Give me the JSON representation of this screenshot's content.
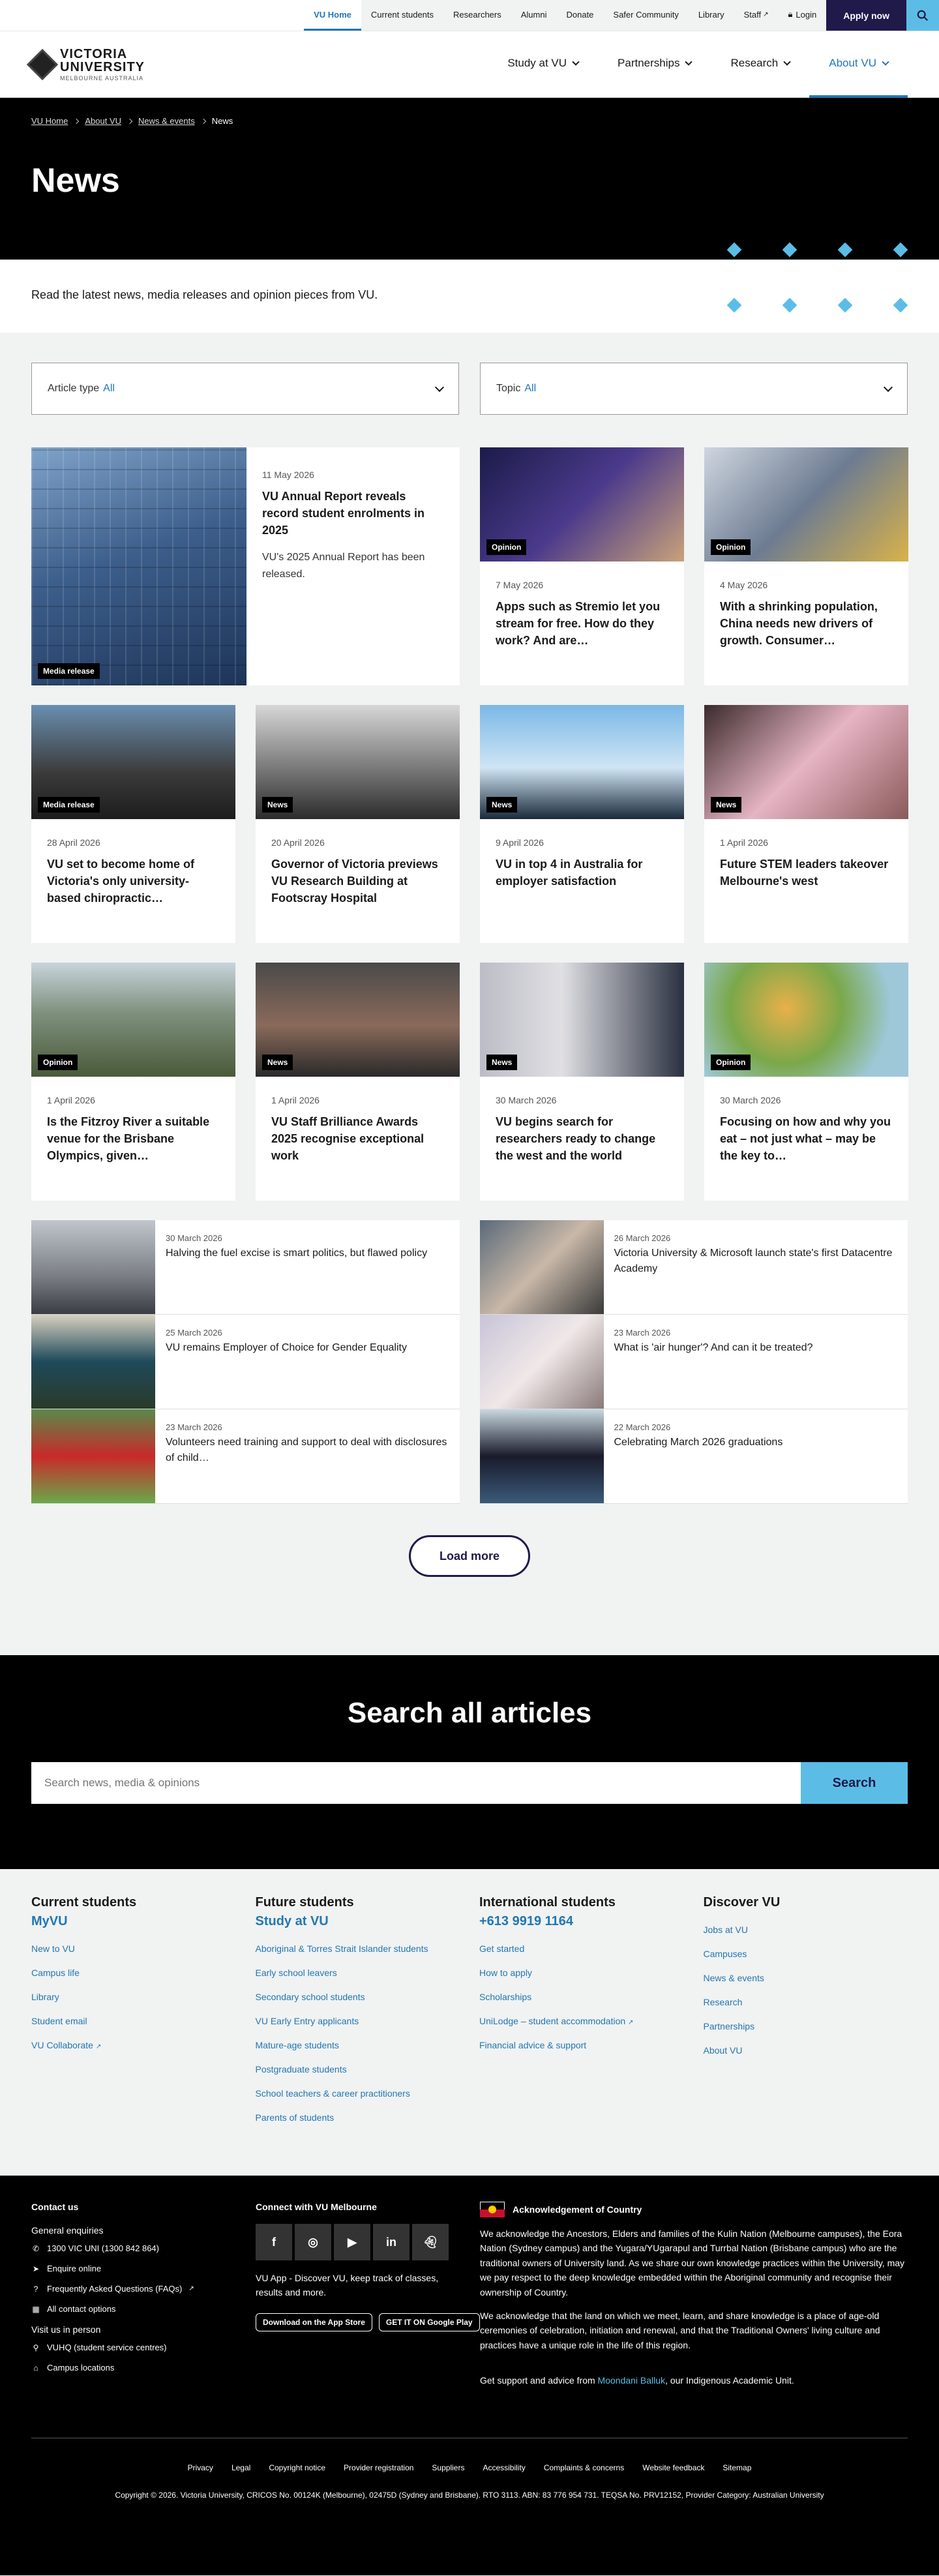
{
  "utility": {
    "links": [
      "VU Home",
      "Current students",
      "Researchers",
      "Alumni",
      "Donate",
      "Safer Community",
      "Library",
      "Staff",
      "Login"
    ],
    "apply": "Apply now"
  },
  "logo": {
    "line1": "VICTORIA",
    "line2": "UNIVERSITY",
    "line3": "MELBOURNE AUSTRALIA"
  },
  "nav": [
    "Study at VU",
    "Partnerships",
    "Research",
    "About VU"
  ],
  "breadcrumb": [
    "VU Home",
    "About VU",
    "News & events",
    "News"
  ],
  "hero": {
    "title": "News"
  },
  "intro": "Read the latest news, media releases and opinion pieces from VU.",
  "filters": [
    {
      "label": "Article type",
      "value": "All"
    },
    {
      "label": "Topic",
      "value": "All"
    }
  ],
  "featured": {
    "tag": "Media release",
    "date": "11 May 2026",
    "title": "VU Annual Report reveals record student enrolments in 2025",
    "desc": "VU's 2025 Annual Report has been released."
  },
  "cards": [
    {
      "tag": "Opinion",
      "date": "7 May 2026",
      "title": "Apps such as Stremio let you stream for free. How do they work? And are…"
    },
    {
      "tag": "Opinion",
      "date": "4 May 2026",
      "title": "With a shrinking population, China needs new drivers of growth. Consumer…"
    },
    {
      "tag": "Media release",
      "date": "28 April 2026",
      "title": "VU set to become home of Victoria's only university-based chiropractic…"
    },
    {
      "tag": "News",
      "date": "20 April 2026",
      "title": "Governor of Victoria previews VU Research Building at Footscray Hospital"
    },
    {
      "tag": "News",
      "date": "9 April 2026",
      "title": "VU in top 4 in Australia for employer satisfaction"
    },
    {
      "tag": "News",
      "date": "1 April 2026",
      "title": "Future STEM leaders takeover Melbourne's west"
    },
    {
      "tag": "Opinion",
      "date": "1 April 2026",
      "title": "Is the Fitzroy River a suitable venue for the Brisbane Olympics, given…"
    },
    {
      "tag": "News",
      "date": "1 April 2026",
      "title": "VU Staff Brilliance Awards 2025 recognise exceptional work"
    },
    {
      "tag": "News",
      "date": "30 March 2026",
      "title": "VU begins search for researchers ready to change the west and the world"
    },
    {
      "tag": "Opinion",
      "date": "30 March 2026",
      "title": "Focusing on how and why you eat – not just what – may be the key to…"
    }
  ],
  "list": [
    {
      "date": "30 March 2026",
      "title": "Halving the fuel excise is smart politics, but flawed policy"
    },
    {
      "date": "26 March 2026",
      "title": "Victoria University & Microsoft launch state's first Datacentre Academy"
    },
    {
      "date": "25 March 2026",
      "title": "VU remains Employer of Choice for Gender Equality"
    },
    {
      "date": "23 March 2026",
      "title": "What is 'air hunger'? And can it be treated?"
    },
    {
      "date": "23 March 2026",
      "title": "Volunteers need training and support to deal with disclosures of child…"
    },
    {
      "date": "22 March 2026",
      "title": "Celebrating March 2026 graduations"
    }
  ],
  "loadmore": "Load more",
  "search": {
    "title": "Search all articles",
    "placeholder": "Search news, media & opinions",
    "button": "Search"
  },
  "sitemap": [
    {
      "title": "Current students",
      "sub": "MyVU",
      "links": [
        "New to VU",
        "Campus life",
        "Library",
        "Student email",
        "VU Collaborate"
      ]
    },
    {
      "title": "Future students",
      "sub": "Study at VU",
      "links": [
        "Aboriginal & Torres Strait Islander students",
        "Early school leavers",
        "Secondary school students",
        "VU Early Entry applicants",
        "Mature-age students",
        "Postgraduate students",
        "School teachers & career practitioners",
        "Parents of students"
      ]
    },
    {
      "title": "International students",
      "sub": "+613 9919 1164",
      "links": [
        "Get started",
        "How to apply",
        "Scholarships",
        "UniLodge – student accommodation",
        "Financial advice & support"
      ]
    },
    {
      "title": "Discover VU",
      "sub": "",
      "links": [
        "Jobs at VU",
        "Campuses",
        "News & events",
        "Research",
        "Partnerships",
        "About VU"
      ]
    }
  ],
  "footer": {
    "contact_title": "Contact us",
    "general_title": "General enquiries",
    "general": [
      "1300 VIC UNI (1300 842 864)",
      "Enquire online",
      "Frequently Asked Questions (FAQs)",
      "All contact options"
    ],
    "person_title": "Visit us in person",
    "person": [
      "VUHQ (student service centres)",
      "Campus locations"
    ],
    "connect_title": "Connect with VU Melbourne",
    "app_text": "VU App - Discover VU, keep track of classes, results and more.",
    "stores": [
      "Download on the App Store",
      "GET IT ON Google Play"
    ],
    "ack_title": "Acknowledgement of Country",
    "ack1": "We acknowledge the Ancestors, Elders and families of the Kulin Nation (Melbourne campuses), the Eora Nation (Sydney campus) and the Yugara/YUgarapul and Turrbal Nation (Brisbane campus) who are the traditional owners of University land. As we share our own knowledge practices within the University, may we pay respect to the deep knowledge embedded within the Aboriginal community and recognise their ownership of Country.",
    "ack2": "We acknowledge that the land on which we meet, learn, and share knowledge is a place of age-old ceremonies of celebration, initiation and renewal, and that the Traditional Owners' living culture and practices have a unique role in the life of this region.",
    "moondani_pre": "Get support and advice from",
    "moondani_link": "Moondani Balluk",
    "moondani_post": ", our Indigenous Academic Unit.",
    "links": [
      "Privacy",
      "Legal",
      "Copyright notice",
      "Provider registration",
      "Suppliers",
      "Accessibility",
      "Complaints & concerns",
      "Website feedback",
      "Sitemap"
    ],
    "copyright": "Copyright © 2026. Victoria University, CRICOS No. 00124K (Melbourne), 02475D (Sydney and Brisbane). RTO 3113. ABN: 83 776 954 731. TEQSA No. PRV12152, Provider Category: Australian University"
  },
  "colors": {
    "navy": "#1f1a4a",
    "accent": "#5bbde6",
    "link": "#2177b5"
  }
}
